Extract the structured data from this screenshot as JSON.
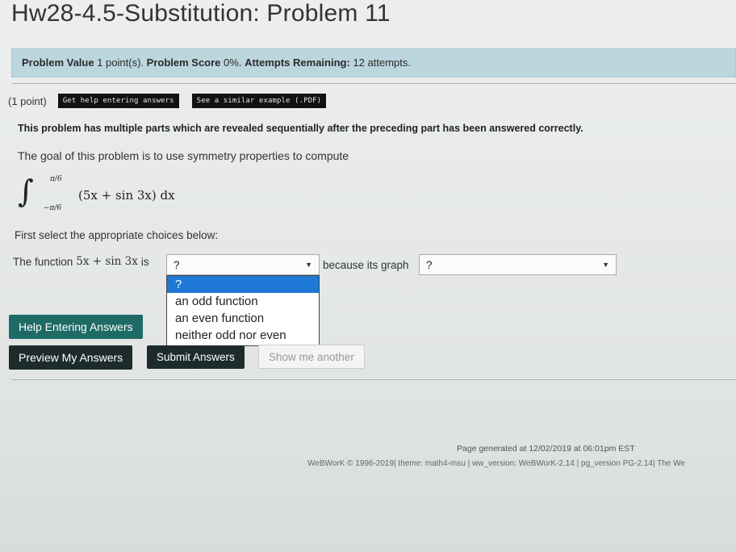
{
  "page": {
    "title": "Hw28-4.5-Substitution: Problem 11"
  },
  "problem_info": {
    "value_label": "Problem Value",
    "value_text": "1 point(s).",
    "score_label": "Problem Score",
    "score_text": "0%.",
    "attempts_label": "Attempts Remaining:",
    "attempts_text": "12 attempts."
  },
  "problem": {
    "points": "(1 point)",
    "help_button": "Get help entering answers",
    "example_button": "See a similar example (.PDF)",
    "sequential_note": "This problem has multiple parts which are revealed sequentially after the preceding part has been answered correctly.",
    "goal": "The goal of this problem is to use symmetry properties to compute",
    "integral": {
      "upper": "π/6",
      "lower": "−π/6",
      "integrand": "(5x + sin 3x) dx"
    },
    "first_select": "First select the appropriate choices below:",
    "function_prefix": "The function",
    "function_expr": "5x + sin 3x",
    "function_is": "is",
    "select1_value": "?",
    "because_text": "because its graph",
    "select2_value": "?",
    "dropdown_options": [
      "?",
      "an odd function",
      "an even function",
      "neither odd nor even"
    ]
  },
  "buttons": {
    "help_entering": "Help Entering Answers",
    "preview": "Preview My Answers",
    "submit": "Submit Answers",
    "show_another": "Show me another"
  },
  "footer": {
    "generated": "Page generated at 12/02/2019 at 06:01pm EST",
    "credits": "WeBWorK © 1996-2019| theme: math4-msu | ww_version: WeBWorK-2.14 | pg_version PG-2.14| The We"
  },
  "colors": {
    "value_bar": "#bcd6de",
    "help_button": "#1e6b66",
    "dark_button": "#1d2b2b",
    "dropdown_highlight": "#1e78d6"
  }
}
